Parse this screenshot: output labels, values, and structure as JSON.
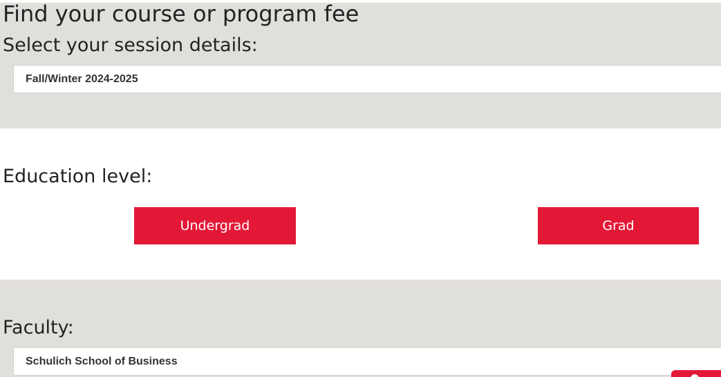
{
  "page": {
    "title": "Find your course or program fee"
  },
  "session": {
    "heading": "Select your session details:",
    "selected": "Fall/Winter 2024-2025"
  },
  "education": {
    "heading": "Education level:",
    "undergrad_label": "Undergrad",
    "grad_label": "Grad"
  },
  "faculty": {
    "heading": "Faculty:",
    "selected": "Schulich School of Business"
  },
  "colors": {
    "accent": "#e31837",
    "band_background": "#e1dfdc"
  },
  "icons": {
    "help_tab": "chat-help-icon"
  }
}
